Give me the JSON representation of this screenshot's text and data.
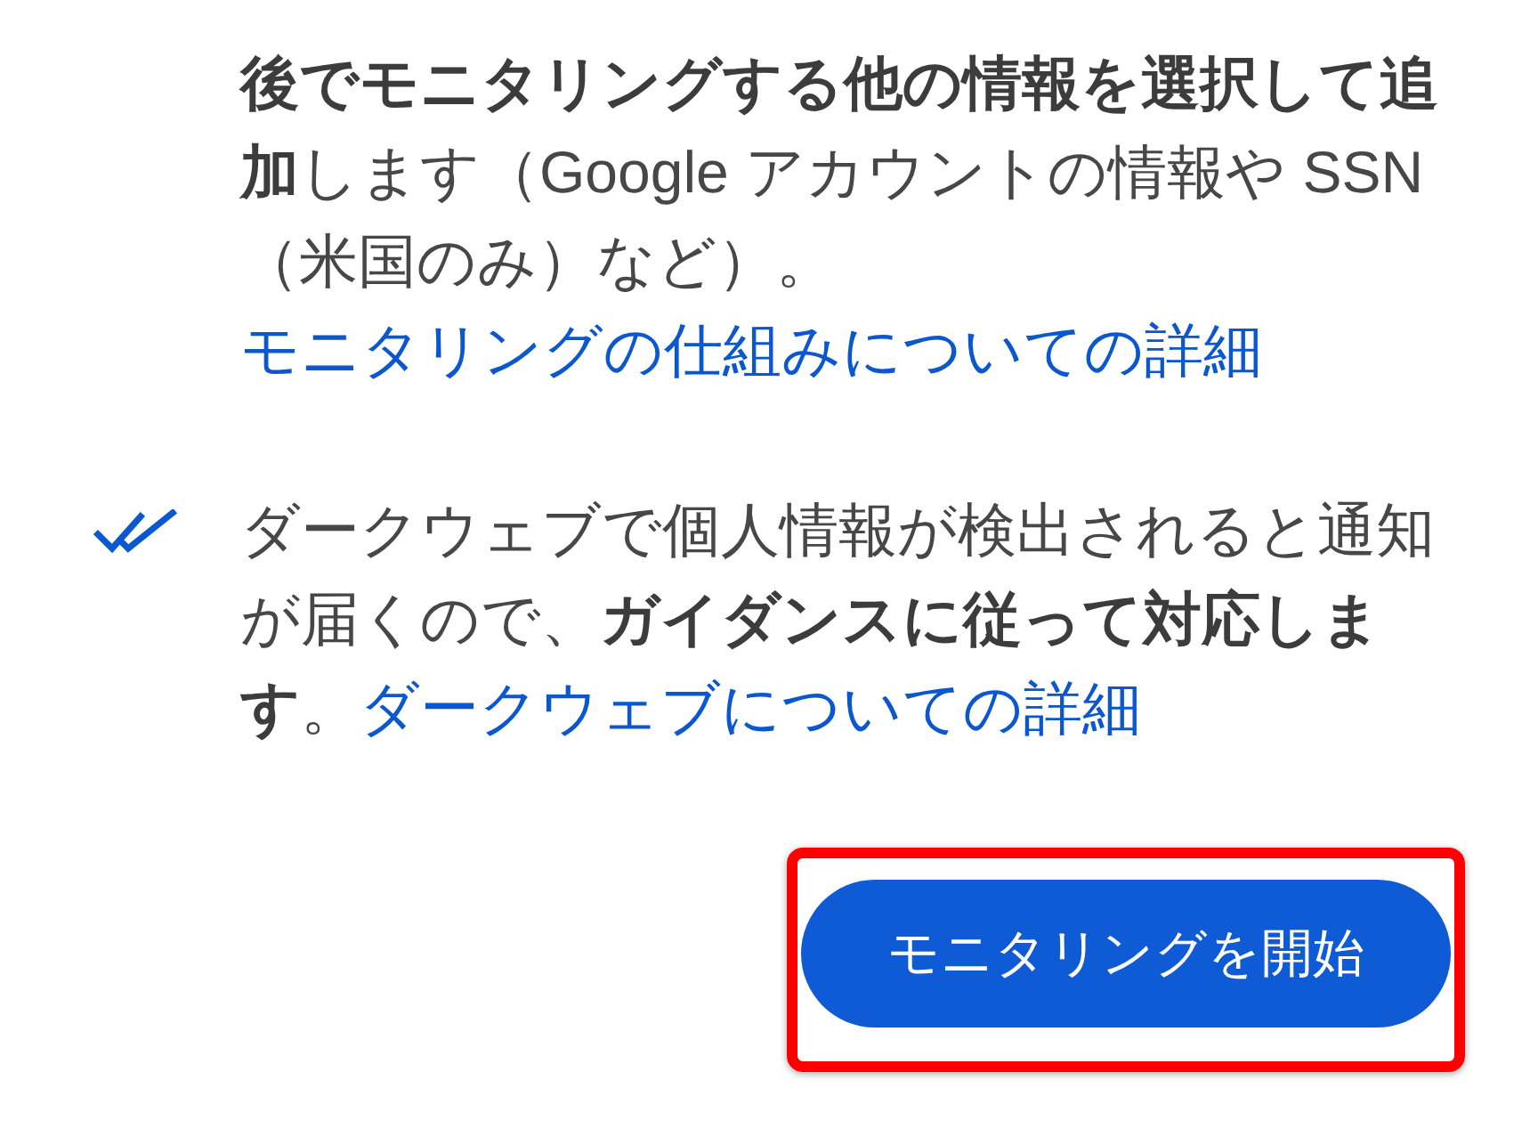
{
  "items": [
    {
      "kind": "plain",
      "text": "**後でモニタリングする他の情報を選択して追加**します（Google アカウントの情報や SSN（米国のみ）など）。",
      "link": "モニタリングの仕組みについての詳細"
    },
    {
      "kind": "check",
      "text": "ダークウェブで個人情報が検出されると通知が届くので、**ガイダンスに従って対応します**。",
      "link": "ダークウェブについての詳細"
    }
  ],
  "button": {
    "label": "モニタリングを開始",
    "highlighted": true
  }
}
